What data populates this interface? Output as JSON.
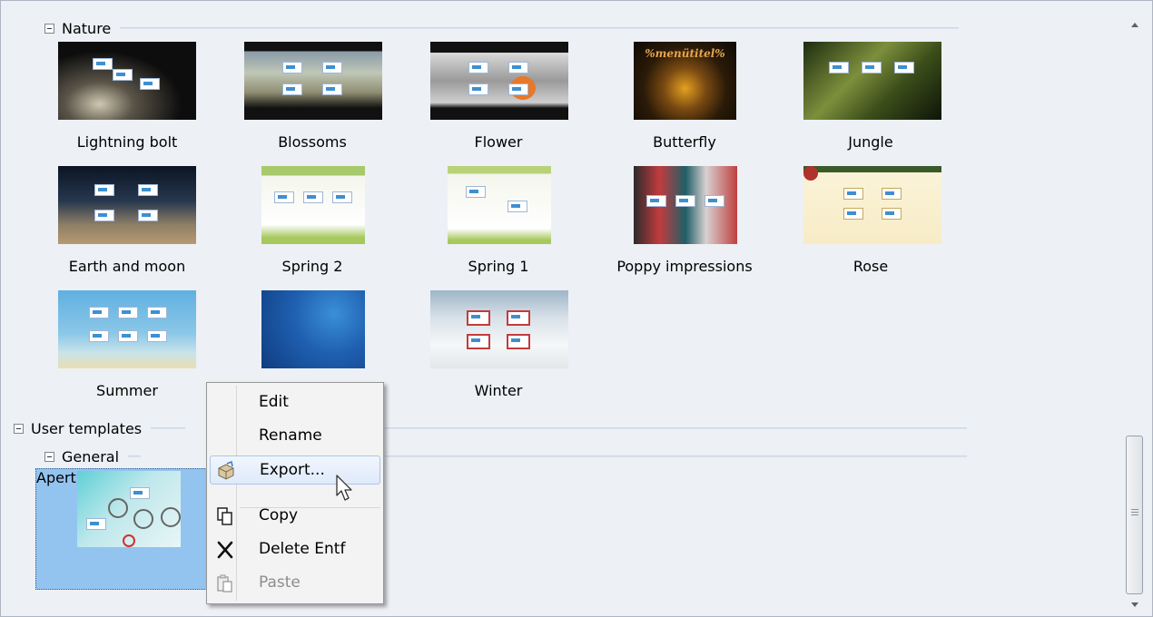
{
  "groups": {
    "nature": {
      "label": "Nature"
    },
    "user_templates": {
      "label": "User templates"
    },
    "general": {
      "label": "General"
    }
  },
  "templates": {
    "lightning_bolt": "Lightning bolt",
    "blossoms": "Blossoms",
    "flower": "Flower",
    "butterfly": "Butterfly",
    "jungle": "Jungle",
    "earth_and_moon": "Earth and moon",
    "spring2": "Spring 2",
    "spring1": "Spring 1",
    "poppy": "Poppy impressions",
    "rose": "Rose",
    "summer": "Summer",
    "winter": "Winter",
    "aperture": "Aperture"
  },
  "thumb_texts": {
    "butterfly_title": "%menütitel%"
  },
  "context_menu": {
    "edit": "Edit",
    "rename": "Rename",
    "export": "Export...",
    "copy": "Copy",
    "delete": "Delete Entf",
    "paste": "Paste"
  },
  "colors": {
    "window_bg": "#edf0f5",
    "selection": "#93c4f0",
    "menu_bg": "#f3f3f3",
    "menu_hover": "#dfeafa"
  },
  "icons": {
    "group_toggle": "minus-box-icon",
    "export": "package-icon",
    "copy": "copy-icon",
    "delete": "scissors-x-icon",
    "paste": "paste-icon",
    "cursor": "arrow-cursor-icon"
  }
}
